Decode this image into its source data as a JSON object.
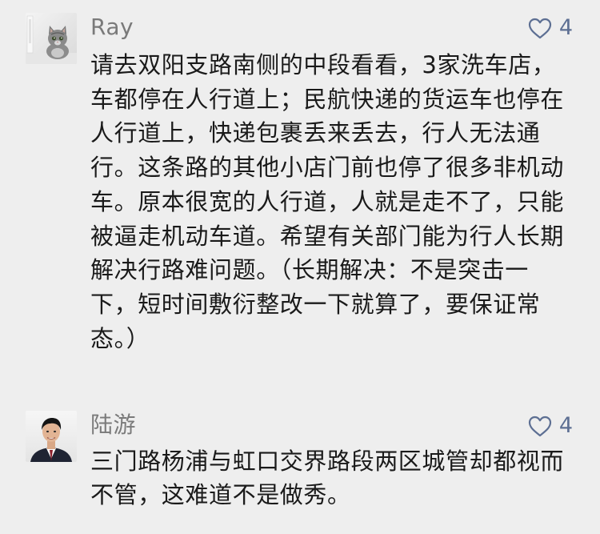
{
  "comments": [
    {
      "author": "Ray",
      "likes": "4",
      "avatar_icon": "kitten-photo",
      "text": "请去双阳支路南侧的中段看看，3家洗车店，车都停在人行道上；民航快递的货运车也停在人行道上，快递包裹丢来丢去，行人无法通行。这条路的其他小店门前也停了很多非机动车。原本很宽的人行道，人就是走不了，只能被逼走机动车道。希望有关部门能为行人长期解决行路难问题。（长期解决：不是突击一下，短时间敷衍整改一下就算了，要保证常态。）"
    },
    {
      "author": "陆游",
      "likes": "4",
      "avatar_icon": "man-in-suit-photo",
      "text": "三门路杨浦与虹口交界路段两区城管却都视而不管，这难道不是做秀。"
    }
  ],
  "colors": {
    "background": "#eeeeee",
    "author": "#7a7a7a",
    "text": "#1a1a1a",
    "like_accent": "#5d6f93"
  }
}
